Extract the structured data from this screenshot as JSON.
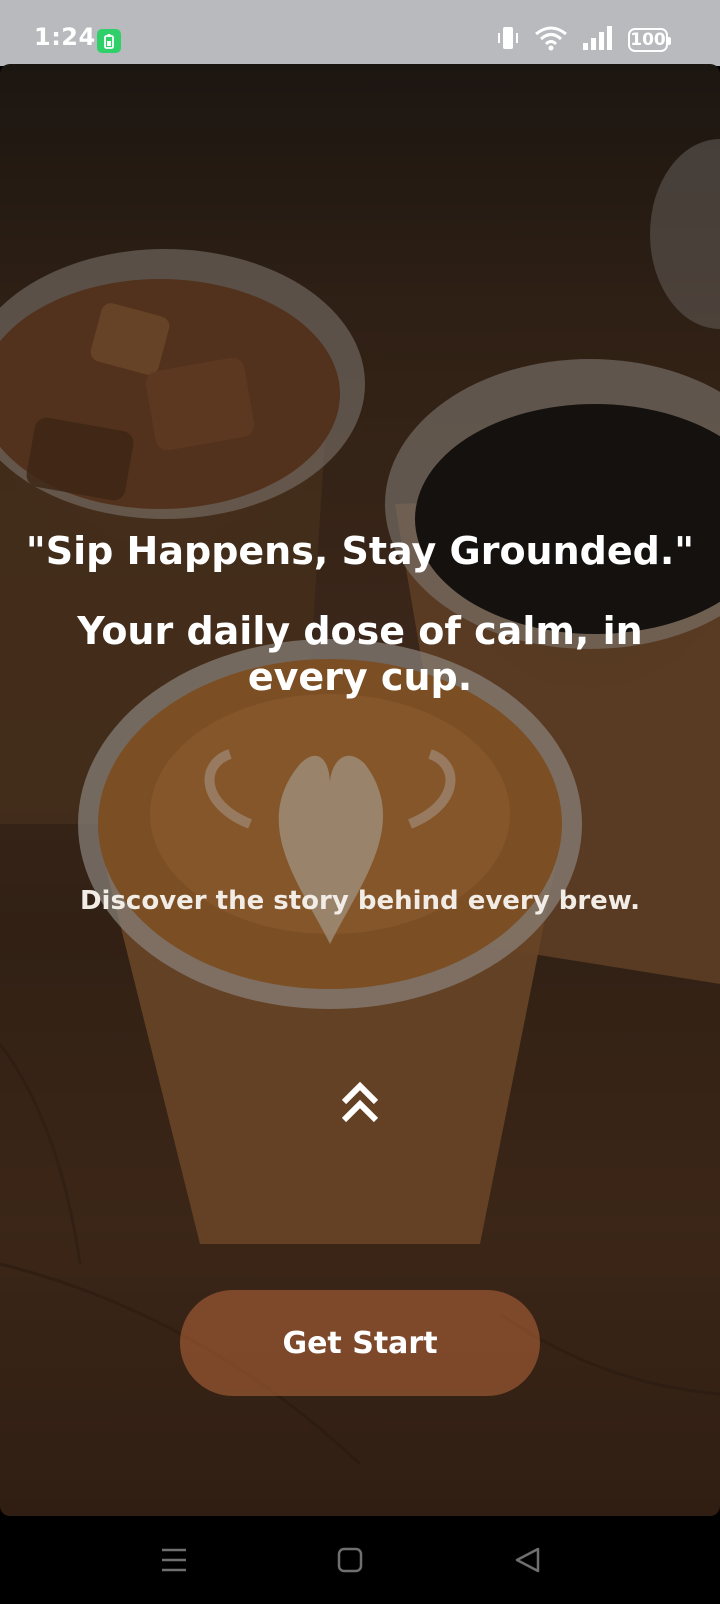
{
  "status_bar": {
    "time": "1:24",
    "battery_saver_icon": "battery-saver-icon",
    "battery_level": "100",
    "icons": [
      "vibrate-icon",
      "wifi-icon",
      "signal-icon",
      "battery-icon"
    ]
  },
  "hero": {
    "quote": "\"Sip Happens, Stay Grounded.\"",
    "tagline": "Your daily dose of calm, in every cup.",
    "subtitle": "Discover the story behind every brew.",
    "swipe_icon": "double-chevron-up-icon"
  },
  "cta": {
    "label": "Get Start",
    "color": "#a35d36"
  },
  "nav_bar": {
    "icons": [
      "menu-icon",
      "home-icon",
      "back-icon"
    ]
  }
}
